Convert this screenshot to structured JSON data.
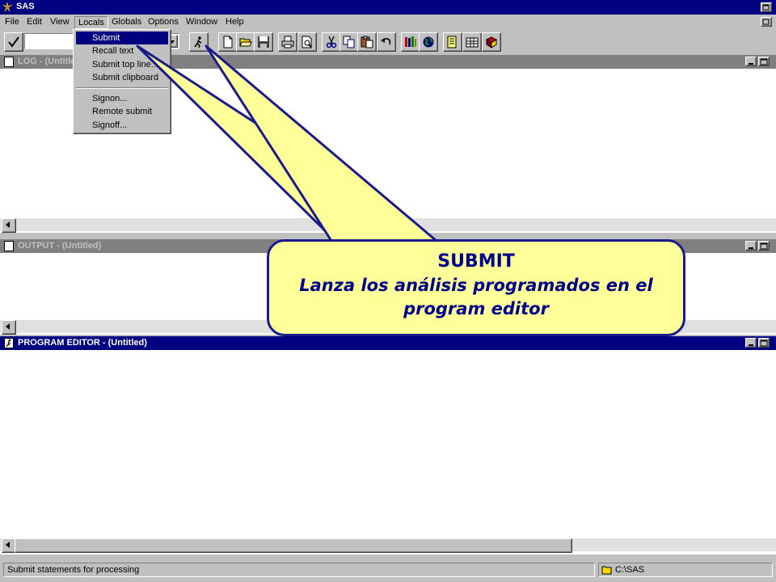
{
  "app": {
    "title": "SAS"
  },
  "menubar": {
    "items": [
      {
        "label": "File",
        "accel": "F"
      },
      {
        "label": "Edit",
        "accel": "E"
      },
      {
        "label": "View",
        "accel": "V"
      },
      {
        "label": "Locals",
        "accel": "L"
      },
      {
        "label": "Globals",
        "accel": "G"
      },
      {
        "label": "Options",
        "accel": "O"
      },
      {
        "label": "Window",
        "accel": "W"
      },
      {
        "label": "Help",
        "accel": "H"
      }
    ]
  },
  "locals_menu": {
    "items": [
      {
        "label": "Submit",
        "highlighted": true
      },
      {
        "label": "Recall text",
        "highlighted": false
      },
      {
        "label": "Submit top line...",
        "highlighted": false
      },
      {
        "label": "Submit clipboard",
        "highlighted": false
      },
      {
        "label": "Signon...",
        "highlighted": false
      },
      {
        "label": "Remote submit",
        "highlighted": false
      },
      {
        "label": "Signoff...",
        "highlighted": false
      }
    ]
  },
  "toolbar": {
    "command_value": "",
    "icons": [
      "checkmark-icon",
      "run-submit-icon",
      "new-icon",
      "open-icon",
      "save-icon",
      "print-icon",
      "print-preview-icon",
      "cut-icon",
      "copy-icon",
      "paste-icon",
      "undo-icon",
      "library-icon",
      "globe-icon",
      "properties-icon",
      "table-icon",
      "help-book-icon"
    ]
  },
  "windows": {
    "log": {
      "title": "LOG - (Untitled)"
    },
    "output": {
      "title": "OUTPUT - (Untitled)"
    },
    "program_editor": {
      "title": "PROGRAM EDITOR - (Untitled)"
    }
  },
  "callout": {
    "title": "SUBMIT",
    "body": "Lanza los análisis programados en el program editor"
  },
  "statusbar": {
    "message": "Submit statements for processing",
    "path": "C:\\SAS"
  },
  "colors": {
    "active_title": "#000080",
    "inactive_title": "#808080",
    "callout_fill": "#ffff99",
    "callout_border": "#1a1a8c",
    "callout_text": "#00008b"
  }
}
